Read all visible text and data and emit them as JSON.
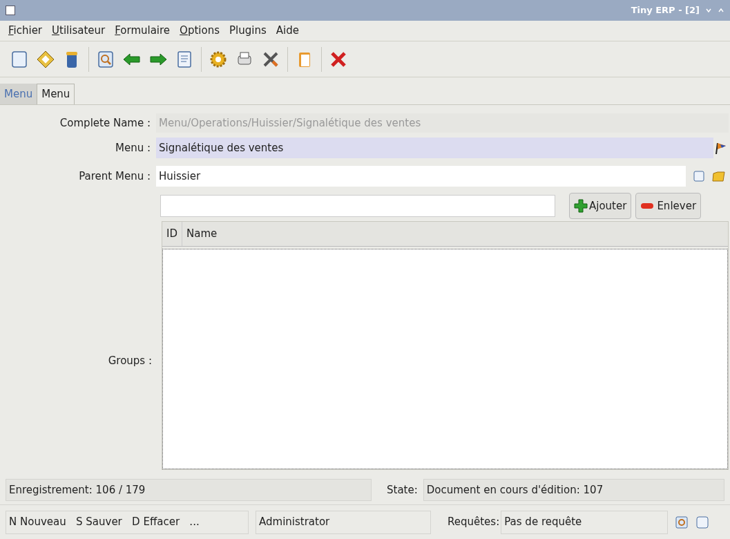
{
  "window": {
    "title": "Tiny ERP - [2]"
  },
  "menu_bar": [
    {
      "label": "Fichier",
      "mnemonic": true
    },
    {
      "label": "Utilisateur",
      "mnemonic": true
    },
    {
      "label": "Formulaire",
      "mnemonic": true
    },
    {
      "label": "Options",
      "mnemonic": true
    },
    {
      "label": "Plugins",
      "mnemonic": false
    },
    {
      "label": "Aide",
      "mnemonic": false
    }
  ],
  "tabs": [
    {
      "label": "Menu",
      "selected": false
    },
    {
      "label": "Menu",
      "selected": true
    }
  ],
  "form": {
    "complete_name": {
      "label": "Complete Name :",
      "value": "Menu/Operations/Huissier/Signalétique des ventes",
      "disabled": true
    },
    "menu": {
      "label": "Menu :",
      "value": "Signalétique des ventes"
    },
    "parent_menu": {
      "label": "Parent Menu :",
      "value": "Huissier"
    },
    "groups": {
      "label": "Groups :",
      "add_button": "Ajouter",
      "remove_button": "Enlever",
      "columns": [
        "ID",
        "Name"
      ]
    }
  },
  "status": {
    "record": "Enregistrement: 106 / 179",
    "state_label": "State:",
    "state": "Document en cours d'édition: 107"
  },
  "footer": {
    "shortcuts": "N Nouveau   S Sauver   D Effacer   ...",
    "user": "Administrator",
    "requests_label": "Requêtes:",
    "requests": "Pas de requête"
  }
}
